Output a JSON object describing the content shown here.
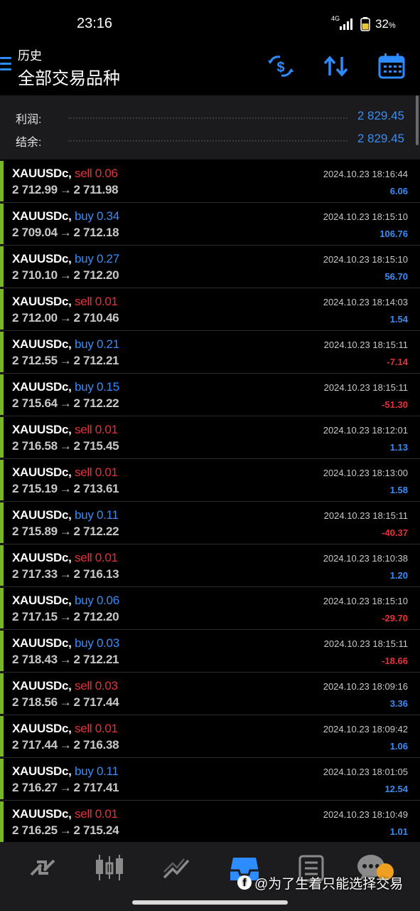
{
  "status_bar": {
    "time": "23:16",
    "network": "4G",
    "battery": "32",
    "battery_unit": "%"
  },
  "header": {
    "subtitle": "历史",
    "title": "全部交易品种"
  },
  "summary": {
    "profit_label": "利润:",
    "profit_value": "2 829.45",
    "balance_label": "结余:",
    "balance_value": "2 829.45"
  },
  "trades": [
    {
      "symbol": "XAUUSDc,",
      "side": "sell",
      "volume": "0.06",
      "open": "2 712.99",
      "close": "2 711.98",
      "time": "2024.10.23 18:16:44",
      "profit": "6.06"
    },
    {
      "symbol": "XAUUSDc,",
      "side": "buy",
      "volume": "0.34",
      "open": "2 709.04",
      "close": "2 712.18",
      "time": "2024.10.23 18:15:10",
      "profit": "106.76"
    },
    {
      "symbol": "XAUUSDc,",
      "side": "buy",
      "volume": "0.27",
      "open": "2 710.10",
      "close": "2 712.20",
      "time": "2024.10.23 18:15:10",
      "profit": "56.70"
    },
    {
      "symbol": "XAUUSDc,",
      "side": "sell",
      "volume": "0.01",
      "open": "2 712.00",
      "close": "2 710.46",
      "time": "2024.10.23 18:14:03",
      "profit": "1.54"
    },
    {
      "symbol": "XAUUSDc,",
      "side": "buy",
      "volume": "0.21",
      "open": "2 712.55",
      "close": "2 712.21",
      "time": "2024.10.23 18:15:11",
      "profit": "-7.14"
    },
    {
      "symbol": "XAUUSDc,",
      "side": "buy",
      "volume": "0.15",
      "open": "2 715.64",
      "close": "2 712.22",
      "time": "2024.10.23 18:15:11",
      "profit": "-51.30"
    },
    {
      "symbol": "XAUUSDc,",
      "side": "sell",
      "volume": "0.01",
      "open": "2 716.58",
      "close": "2 715.45",
      "time": "2024.10.23 18:12:01",
      "profit": "1.13"
    },
    {
      "symbol": "XAUUSDc,",
      "side": "sell",
      "volume": "0.01",
      "open": "2 715.19",
      "close": "2 713.61",
      "time": "2024.10.23 18:13:00",
      "profit": "1.58"
    },
    {
      "symbol": "XAUUSDc,",
      "side": "buy",
      "volume": "0.11",
      "open": "2 715.89",
      "close": "2 712.22",
      "time": "2024.10.23 18:15:11",
      "profit": "-40.37"
    },
    {
      "symbol": "XAUUSDc,",
      "side": "sell",
      "volume": "0.01",
      "open": "2 717.33",
      "close": "2 716.13",
      "time": "2024.10.23 18:10:38",
      "profit": "1.20"
    },
    {
      "symbol": "XAUUSDc,",
      "side": "buy",
      "volume": "0.06",
      "open": "2 717.15",
      "close": "2 712.20",
      "time": "2024.10.23 18:15:10",
      "profit": "-29.70"
    },
    {
      "symbol": "XAUUSDc,",
      "side": "buy",
      "volume": "0.03",
      "open": "2 718.43",
      "close": "2 712.21",
      "time": "2024.10.23 18:15:11",
      "profit": "-18.66"
    },
    {
      "symbol": "XAUUSDc,",
      "side": "sell",
      "volume": "0.03",
      "open": "2 718.56",
      "close": "2 717.44",
      "time": "2024.10.23 18:09:16",
      "profit": "3.36"
    },
    {
      "symbol": "XAUUSDc,",
      "side": "sell",
      "volume": "0.01",
      "open": "2 717.44",
      "close": "2 716.38",
      "time": "2024.10.23 18:09:42",
      "profit": "1.06"
    },
    {
      "symbol": "XAUUSDc,",
      "side": "buy",
      "volume": "0.11",
      "open": "2 716.27",
      "close": "2 717.41",
      "time": "2024.10.23 18:01:05",
      "profit": "12.54"
    },
    {
      "symbol": "XAUUSDc,",
      "side": "sell",
      "volume": "0.01",
      "open": "2 716.25",
      "close": "2 715.24",
      "time": "2024.10.23 18:10:49",
      "profit": "1.01"
    }
  ],
  "arrow_glyph": "→",
  "header_icons": [
    "currency-toggle-icon",
    "sort-icon",
    "calendar-icon"
  ],
  "bottom_nav": [
    "quotes-icon",
    "chart-icon",
    "trade-icon",
    "history-icon",
    "news-icon",
    "messages-icon"
  ],
  "watermark": {
    "text": "@为了生着只能选择交易",
    "logo": "f"
  },
  "colors": {
    "accent": "#3b8cf5",
    "sell": "#e5323a",
    "buy": "#3b8cf5",
    "row_marker": "#7ab52d"
  }
}
